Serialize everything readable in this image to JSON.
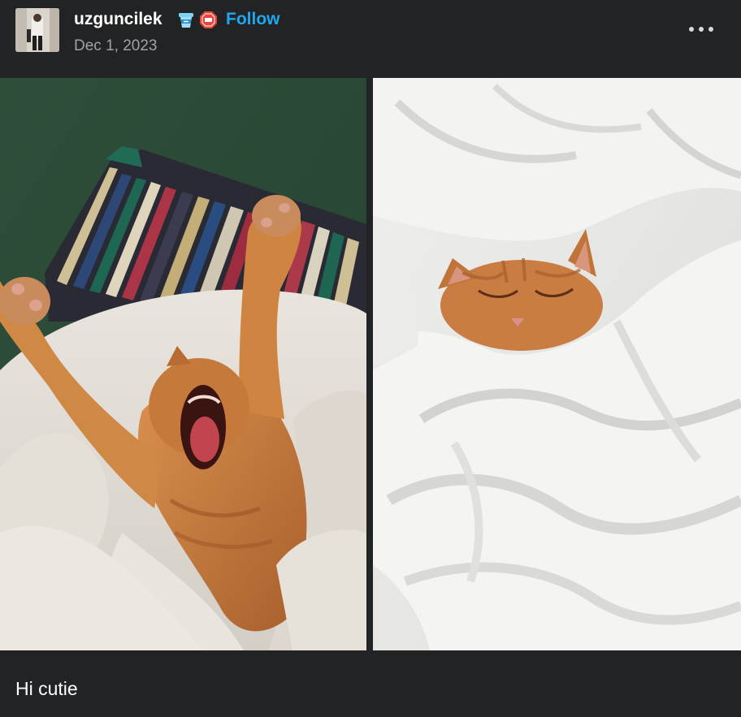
{
  "post": {
    "username": "uzguncilek",
    "follow_label": "Follow",
    "date": "Dec 1, 2023",
    "caption": "Hi cutie"
  },
  "icons": {
    "avatar": "user-avatar",
    "badge_1": "coffee-cup-badge-icon",
    "badge_2": "sticker-badge-icon",
    "more": "more-options-icon"
  },
  "colors": {
    "background": "#222324",
    "follow": "#20a7ee",
    "date": "#a1a2a3"
  }
}
